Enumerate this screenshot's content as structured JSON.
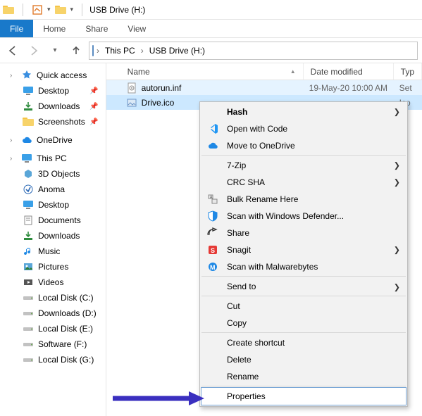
{
  "titlebar": {
    "title": "USB Drive (H:)"
  },
  "ribbon": {
    "file": "File",
    "home": "Home",
    "share": "Share",
    "view": "View"
  },
  "breadcrumb": {
    "root": "This PC",
    "leaf": "USB Drive (H:)"
  },
  "columns": {
    "name": "Name",
    "date": "Date modified",
    "type": "Typ"
  },
  "files": [
    {
      "name": "autorun.inf",
      "date": "19-May-20 10:00 AM",
      "type": "Set"
    },
    {
      "name": "Drive.ico",
      "date": "",
      "type": "Ico"
    }
  ],
  "nav": {
    "quick_access": "Quick access",
    "desktop": "Desktop",
    "downloads": "Downloads",
    "screenshots": "Screenshots",
    "onedrive": "OneDrive",
    "this_pc": "This PC",
    "pc_children": {
      "objects3d": "3D Objects",
      "anoma": "Anoma",
      "desktop": "Desktop",
      "documents": "Documents",
      "downloads": "Downloads",
      "music": "Music",
      "pictures": "Pictures",
      "videos": "Videos",
      "local_c": "Local Disk (C:)",
      "downloads_d": "Downloads  (D:)",
      "local_e": "Local Disk (E:)",
      "software_f": "Software (F:)",
      "local_g": "Local Disk (G:)"
    }
  },
  "context_menu": {
    "hash": "Hash",
    "open_with_code": "Open with Code",
    "move_to_onedrive": "Move to OneDrive",
    "seven_zip": "7-Zip",
    "crc_sha": "CRC SHA",
    "bulk_rename": "Bulk Rename Here",
    "defender": "Scan with Windows Defender...",
    "share": "Share",
    "snagit": "Snagit",
    "malwarebytes": "Scan with Malwarebytes",
    "send_to": "Send to",
    "cut": "Cut",
    "copy": "Copy",
    "create_shortcut": "Create shortcut",
    "delete": "Delete",
    "rename": "Rename",
    "properties": "Properties"
  }
}
